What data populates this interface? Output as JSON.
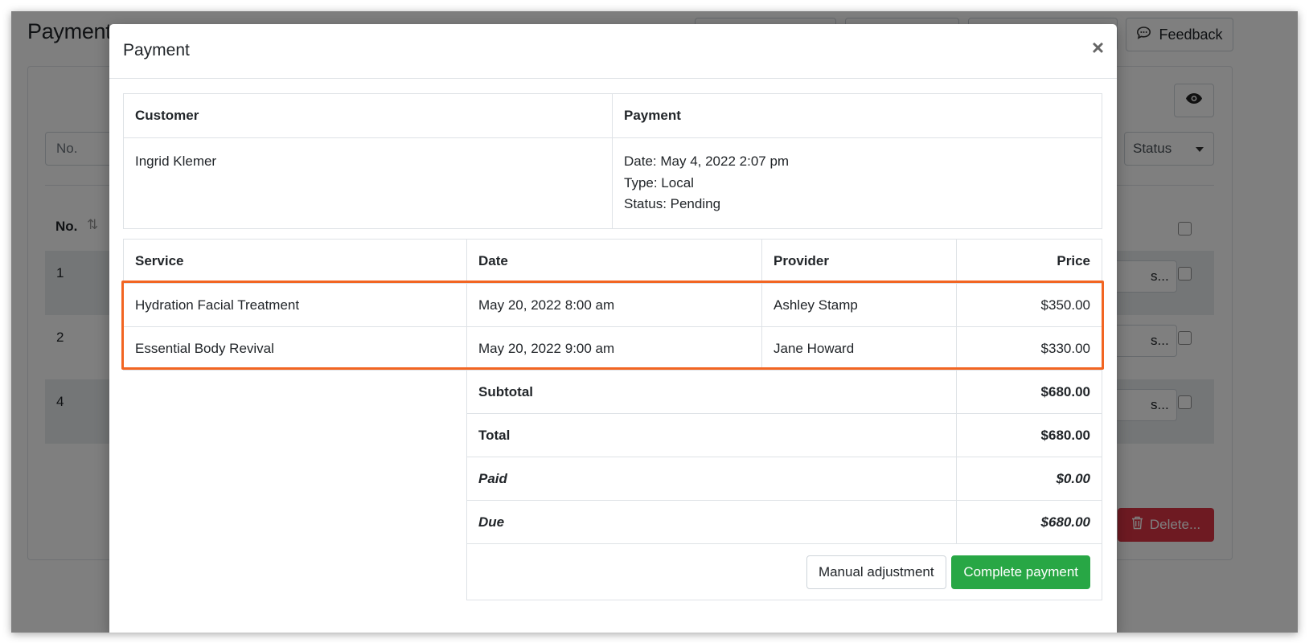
{
  "background": {
    "page_title": "Payments",
    "feedback_label": "Feedback",
    "search_placeholder": "No.",
    "status_filter": "Status",
    "col_no": "No.",
    "rows": [
      {
        "no": "1",
        "action": "s..."
      },
      {
        "no": "2",
        "action": "s..."
      },
      {
        "no": "4",
        "action": "s..."
      }
    ],
    "delete_label": "Delete..."
  },
  "modal": {
    "title": "Payment",
    "close": "×",
    "customer_header": "Customer",
    "payment_header": "Payment",
    "customer_name": "Ingrid Klemer",
    "payment_date": "Date: May 4, 2022 2:07 pm",
    "payment_type": "Type: Local",
    "payment_status": "Status: Pending",
    "services": {
      "headers": {
        "service": "Service",
        "date": "Date",
        "provider": "Provider",
        "price": "Price"
      },
      "rows": [
        {
          "service": "Hydration Facial Treatment",
          "date": "May 20, 2022 8:00 am",
          "provider": "Ashley Stamp",
          "price": "$350.00"
        },
        {
          "service": "Essential Body Revival",
          "date": "May 20, 2022 9:00 am",
          "provider": "Jane Howard",
          "price": "$330.00"
        }
      ]
    },
    "totals": {
      "subtotal_label": "Subtotal",
      "subtotal": "$680.00",
      "total_label": "Total",
      "total": "$680.00",
      "paid_label": "Paid",
      "paid": "$0.00",
      "due_label": "Due",
      "due": "$680.00"
    },
    "buttons": {
      "manual_adjustment": "Manual adjustment",
      "complete_payment": "Complete payment"
    }
  },
  "colors": {
    "highlight": "#f26522",
    "success": "#28a745",
    "danger": "#dc3545"
  }
}
